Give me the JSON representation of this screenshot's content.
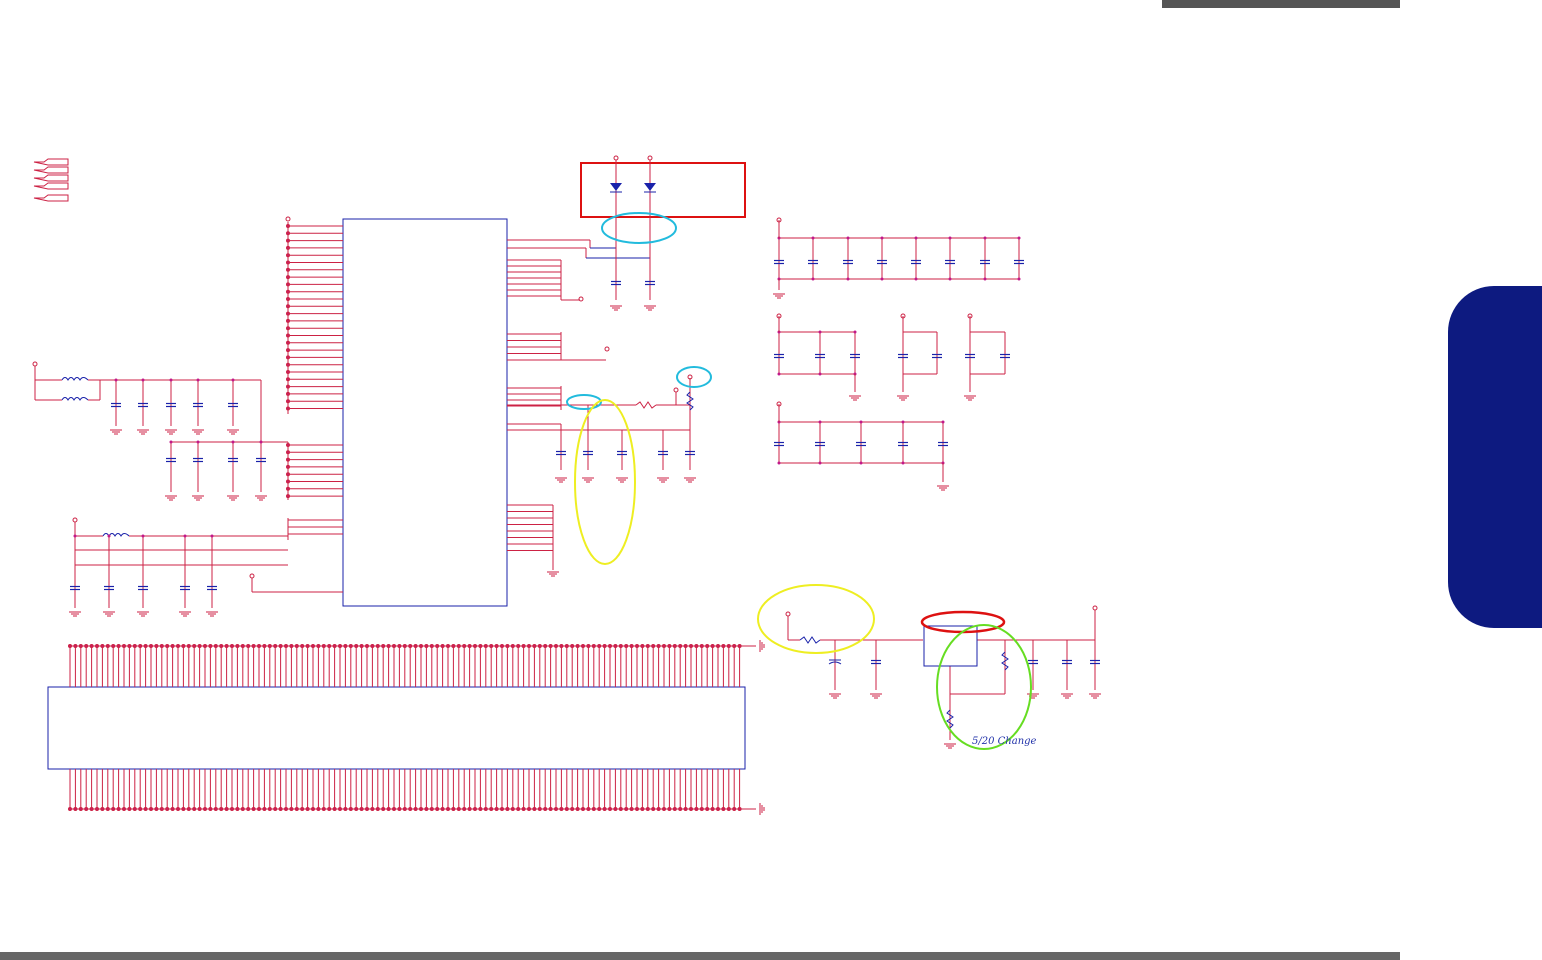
{
  "annotations": {
    "change_note": "5/20 Change"
  },
  "colors": {
    "wire": "#cc2244",
    "component_outline": "#1a22aa",
    "pin_dot": "#c2188a",
    "highlight_red": "#dd1111",
    "highlight_cyan": "#22bbdd",
    "highlight_yellow": "#eeee22",
    "highlight_green": "#66dd22",
    "side_tab": "#0d1a80",
    "header_bar": "#555555"
  },
  "icons": {
    "diode": "diode-icon",
    "capacitor": "capacitor-icon",
    "ground": "ground-icon",
    "inductor": "inductor-icon",
    "resistor": "resistor-icon"
  }
}
